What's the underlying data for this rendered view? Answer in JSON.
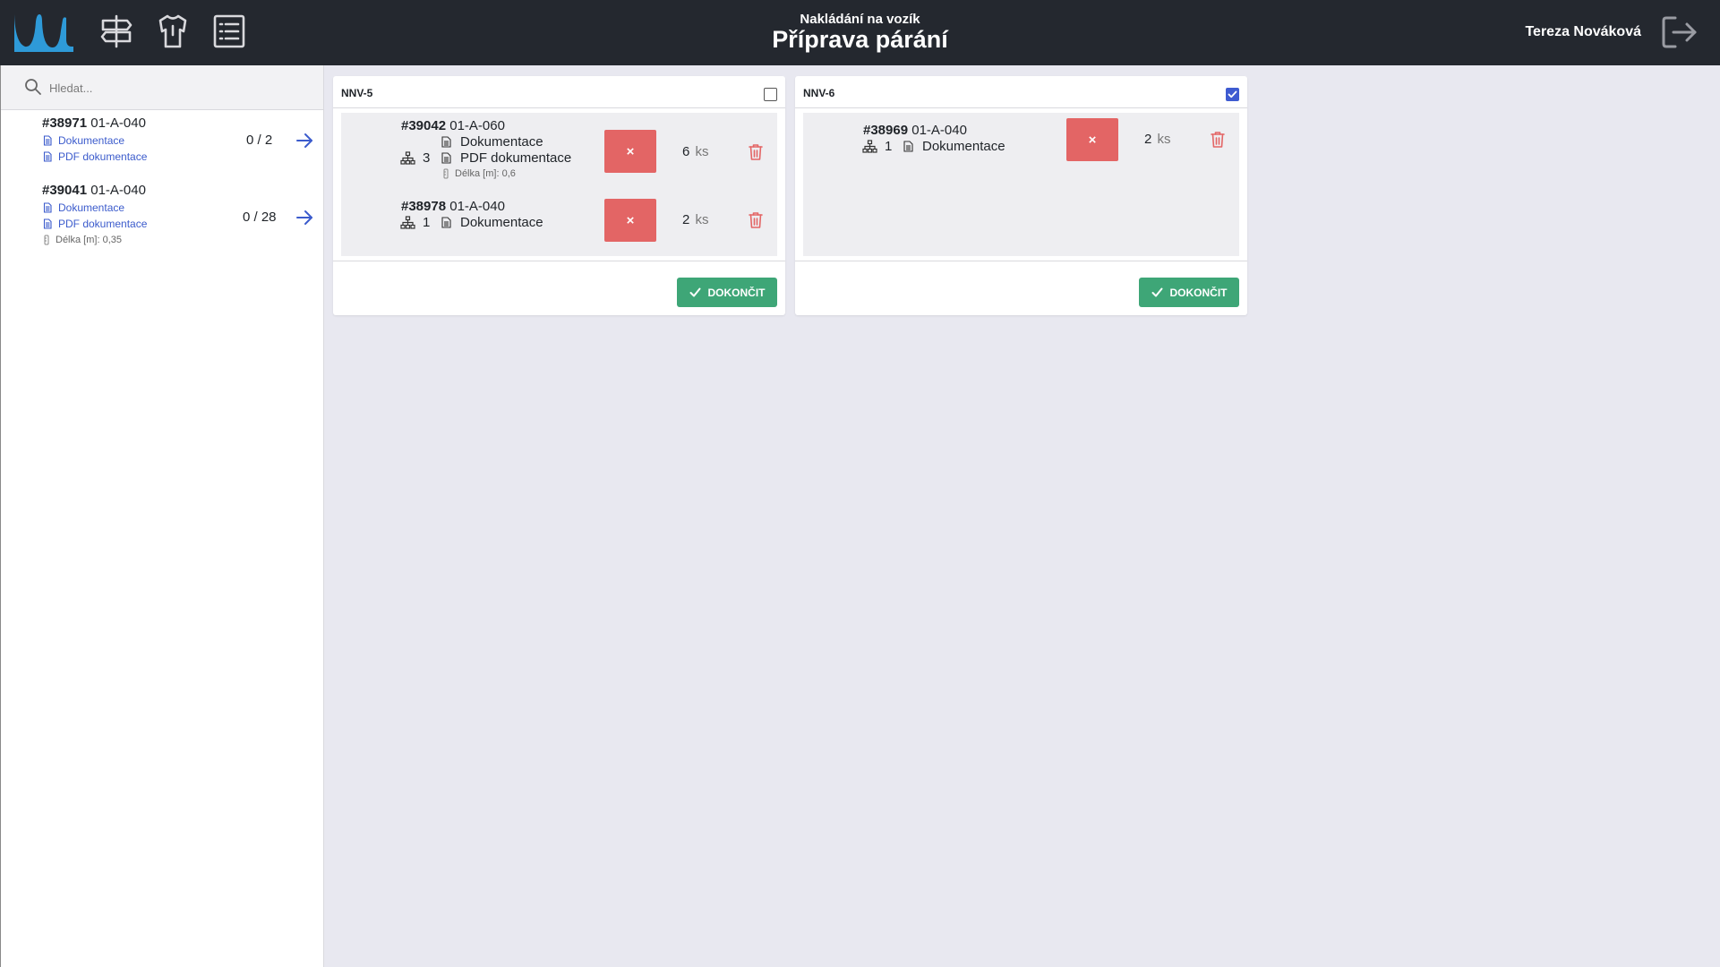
{
  "header": {
    "subtitle": "Nakládání na vozík",
    "title": "Příprava párání",
    "user": "Tereza Nováková"
  },
  "colors": {
    "header_bg": "#24282f",
    "brand_blue": "#2e9ad8",
    "link_blue": "#3b5bcc",
    "danger": "#e36565",
    "success": "#3ea677",
    "checkbox_checked": "#3e5bd1"
  },
  "icons": {
    "nav": [
      "signpost-icon",
      "shirt-icon",
      "list-icon"
    ],
    "logout": "logout-icon"
  },
  "search": {
    "placeholder": "Hledat...",
    "value": ""
  },
  "sidebar": {
    "items": [
      {
        "id": "#38971",
        "location": "01-A-040",
        "docs": [
          "Dokumentace",
          "PDF dokumentace"
        ],
        "length_label": "",
        "count": "0 / 2"
      },
      {
        "id": "#39041",
        "location": "01-A-040",
        "docs": [
          "Dokumentace",
          "PDF dokumentace"
        ],
        "length_label": "Délka [m]:",
        "length_value": "0,35",
        "count": "0 / 28"
      }
    ]
  },
  "cards": [
    {
      "name": "NNV-5",
      "checked": false,
      "finish_label": "DOKONČIT",
      "rows": [
        {
          "id": "#39042",
          "location": "01-A-060",
          "tree_count": "3",
          "docs": [
            "Dokumentace",
            "PDF dokumentace"
          ],
          "length_label": "Délka [m]:",
          "length_value": "0,6",
          "x_label": "×",
          "qty": "6",
          "unit": "ks"
        },
        {
          "id": "#38978",
          "location": "01-A-040",
          "tree_count": "1",
          "docs": [
            "Dokumentace"
          ],
          "x_label": "×",
          "qty": "2",
          "unit": "ks"
        }
      ]
    },
    {
      "name": "NNV-6",
      "checked": true,
      "finish_label": "DOKONČIT",
      "rows": [
        {
          "id": "#38969",
          "location": "01-A-040",
          "tree_count": "1",
          "docs": [
            "Dokumentace"
          ],
          "x_label": "×",
          "qty": "2",
          "unit": "ks"
        }
      ]
    }
  ]
}
